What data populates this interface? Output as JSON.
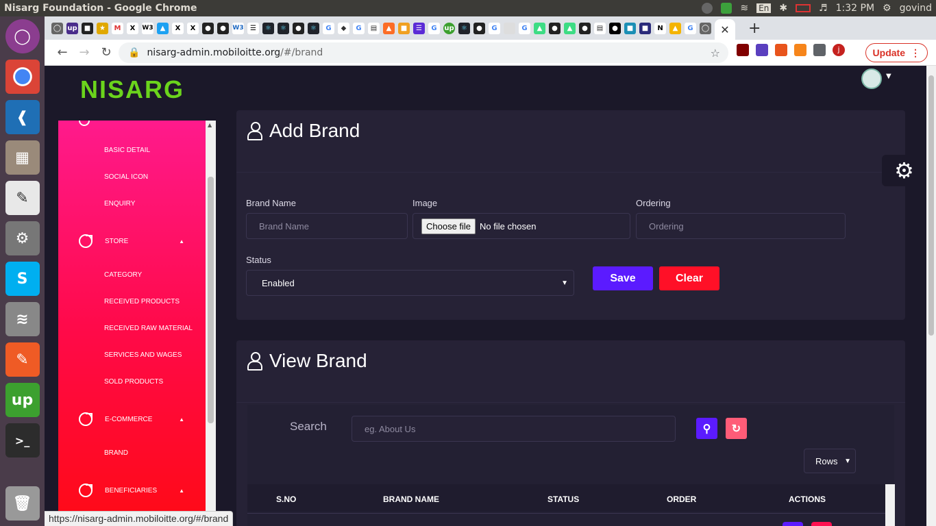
{
  "os": {
    "window_title": "Nisarg Foundation - Google Chrome",
    "tray": {
      "keyboard": "En",
      "time": "1:32 PM",
      "user": "govind"
    }
  },
  "browser": {
    "url_host": "nisarg-admin.mobiloitte.org",
    "url_path": "/#/brand",
    "update_label": "Update",
    "profile_initial": "j",
    "status_url": "https://nisarg-admin.mobiloitte.org/#/brand",
    "tab_favicons": [
      "github",
      "upwork-u",
      "gcode",
      "pin",
      "gmail",
      "x",
      "x",
      "w3",
      "bird",
      "x",
      "x",
      "github",
      "github",
      "w3",
      "grid",
      "react",
      "react",
      "github",
      "react",
      "google",
      "codepen",
      "google",
      "book",
      "gitlab",
      "orange",
      "list",
      "google",
      "upwork",
      "react",
      "github",
      "google",
      "grey",
      "google",
      "android",
      "github",
      "android",
      "github",
      "book",
      "medium",
      "cube",
      "figma",
      "notion",
      "drive",
      "google",
      "github"
    ]
  },
  "app": {
    "logo": "NISARG",
    "sidebar": {
      "items": [
        {
          "label": "BASIC DETAIL"
        },
        {
          "label": "SOCIAL ICON"
        },
        {
          "label": "ENQUIRY"
        }
      ],
      "store": {
        "label": "STORE",
        "children": [
          "CATEGORY",
          "RECEIVED PRODUCTS",
          "RECEIVED RAW MATERIAL",
          "SERVICES AND WAGES",
          "SOLD PRODUCTS"
        ]
      },
      "ecommerce": {
        "label": "E-COMMERCE",
        "children": [
          "BRAND"
        ]
      },
      "beneficiaries": {
        "label": "BENEFICIARIES"
      }
    },
    "add_brand": {
      "title": "Add Brand",
      "brand_name_label": "Brand Name",
      "brand_name_placeholder": "Brand Name",
      "image_label": "Image",
      "choose_file": "Choose file",
      "no_file": "No file chosen",
      "ordering_label": "Ordering",
      "ordering_placeholder": "Ordering",
      "status_label": "Status",
      "status_value": "Enabled",
      "save_label": "Save",
      "clear_label": "Clear"
    },
    "view_brand": {
      "title": "View Brand",
      "search_label": "Search",
      "search_placeholder": "eg. About Us",
      "rows_label": "Rows",
      "columns": [
        "S.NO",
        "BRAND NAME",
        "STATUS",
        "ORDER",
        "ACTIONS"
      ]
    }
  },
  "colors": {
    "accent_purple": "#5b1bff",
    "accent_red": "#ff1027",
    "logo_green": "#6bd41c"
  }
}
